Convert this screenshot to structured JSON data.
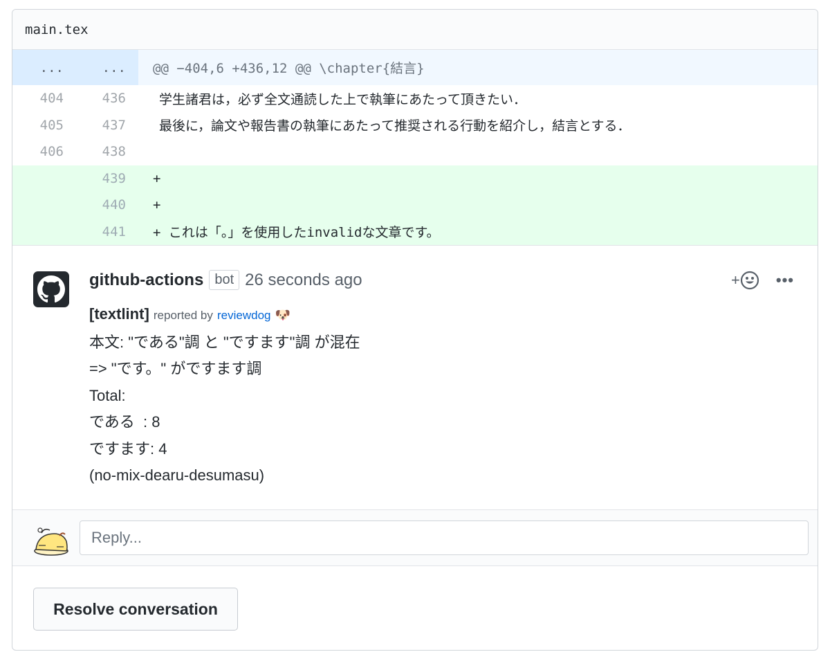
{
  "file": {
    "name": "main.tex"
  },
  "hunk": {
    "left": "...",
    "right": "...",
    "header": "@@ −404,6 +436,12 @@ \\chapter{結言}"
  },
  "lines": [
    {
      "old": "404",
      "new": "436",
      "text": "学生諸君は，必ず全文通読した上で執筆にあたって頂きたい．"
    },
    {
      "old": "405",
      "new": "437",
      "text": "最後に，論文や報告書の執筆にあたって推奨される行動を紹介し，結言とする．"
    },
    {
      "old": "406",
      "new": "438",
      "text": ""
    },
    {
      "old": "",
      "new": "439",
      "text": "+"
    },
    {
      "old": "",
      "new": "440",
      "text": "+"
    },
    {
      "old": "",
      "new": "441",
      "text": "+ これは「。」を使用したinvalidな文章です。"
    }
  ],
  "comment": {
    "author": "github-actions",
    "badge": "bot",
    "time": "26 seconds ago",
    "reaction_label": "+",
    "more_label": "•••",
    "tag": "[textlint]",
    "reported_by": "reported by",
    "link": "reviewdog",
    "body": [
      "本文: \"である\"調 と \"ですます\"調 が混在",
      "=> \"です。\" がですます調",
      "Total:",
      "である  : 8",
      "ですます: 4",
      "(no-mix-dearu-desumasu)"
    ]
  },
  "reply": {
    "placeholder": "Reply..."
  },
  "resolve": {
    "label": "Resolve conversation"
  },
  "icons": {
    "author_avatar": "github-octocat-icon",
    "reaction": "smiley-icon",
    "dog": "dog-emoji-icon",
    "me_avatar": "user-avatar-icon"
  }
}
